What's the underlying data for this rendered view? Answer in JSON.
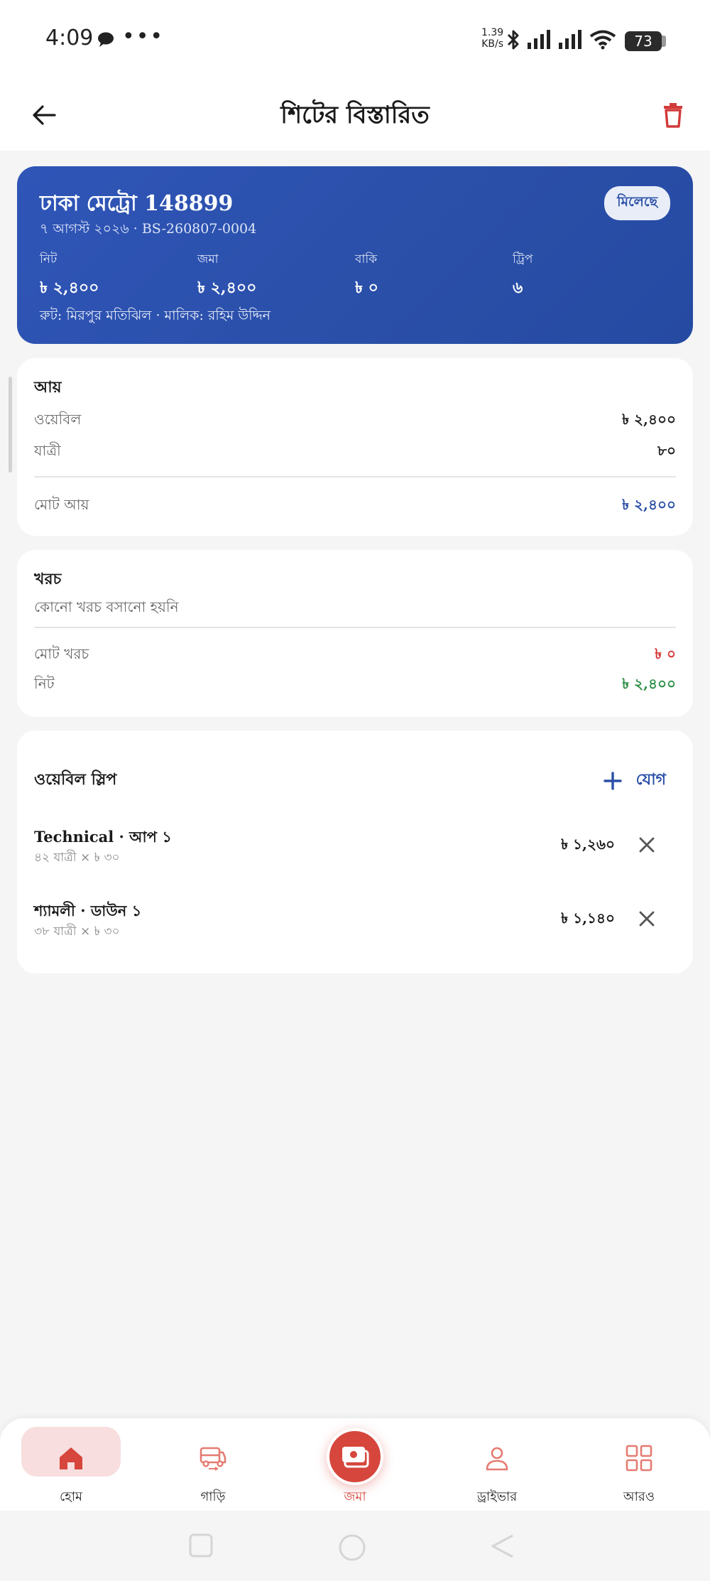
{
  "status_bar": {
    "time": "4:09",
    "network_speed_value": "1.39",
    "network_speed_unit": "KB/s",
    "battery": "73"
  },
  "header": {
    "title": "শিটের বিস্তারিত",
    "back_icon": "arrow-left-icon",
    "delete_icon": "trash-icon"
  },
  "summary": {
    "title": "ঢাকা মেট্রো 148899",
    "subtitle": "৭ আগস্ট ২০২৬ · BS-260807-0004",
    "badge": "মিলেছে",
    "stats": [
      {
        "label": "নিট",
        "value": "৳ ২,৪০০"
      },
      {
        "label": "জমা",
        "value": "৳ ২,৪০০"
      },
      {
        "label": "বাকি",
        "value": "৳ ০"
      },
      {
        "label": "ট্রিপ",
        "value": "৬"
      }
    ],
    "route": "রুট: মিরপুর মতিঝিল · মালিক: রহিম উদ্দিন"
  },
  "income": {
    "title": "আয়",
    "rows": [
      {
        "label": "ওয়েবিল",
        "value": "৳ ২,৪০০"
      },
      {
        "label": "যাত্রী",
        "value": "৮০"
      }
    ],
    "total_label": "মোট আয়",
    "total_value": "৳ ২,৪০০"
  },
  "expense": {
    "title": "খরচ",
    "empty_text": "কোনো খরচ বসানো হয়নি",
    "total_label": "মোট খরচ",
    "total_value": "৳ ০",
    "net_label": "নিট",
    "net_value": "৳ ২,৪০০"
  },
  "slips": {
    "title": "ওয়েবিল স্লিপ",
    "add_label": "যোগ",
    "items": [
      {
        "title": "Technical · আপ ১",
        "meta": "৪২ যাত্রী × ৳ ৩০",
        "amount": "৳ ১,২৬০"
      },
      {
        "title": "শ্যামলী · ডাউন ১",
        "meta": "৩৮ যাত্রী × ৳ ৩০",
        "amount": "৳ ১,১৪০"
      }
    ]
  },
  "bottom_nav": {
    "items": [
      {
        "label": "হোম",
        "icon": "home-icon",
        "active": true
      },
      {
        "label": "গাড়ি",
        "icon": "bus-icon",
        "active": false
      },
      {
        "label": "জমা",
        "icon": "cash-icon",
        "active": false
      },
      {
        "label": "ড্রাইভার",
        "icon": "person-icon",
        "active": false
      },
      {
        "label": "আরও",
        "icon": "grid-icon",
        "active": false
      }
    ]
  },
  "colors": {
    "primary": "#2a4fa8",
    "accent": "#d6463c",
    "negative": "#d23a3a",
    "positive": "#2f8f45"
  }
}
